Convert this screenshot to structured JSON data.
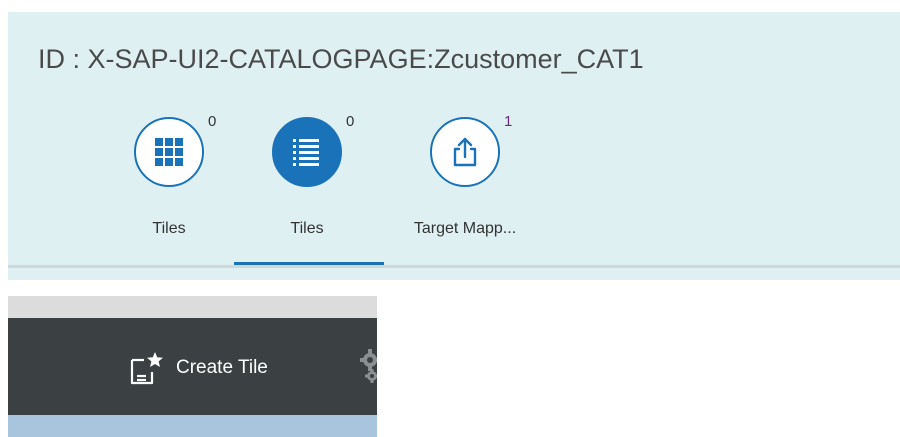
{
  "header": {
    "title": "ID : X-SAP-UI2-CATALOGPAGE:Zcustomer_CAT1"
  },
  "tabs": [
    {
      "label": "Tiles",
      "count": "0",
      "icon": "grid-icon",
      "selected": false
    },
    {
      "label": "Tiles",
      "count": "0",
      "icon": "list-icon",
      "selected": true
    },
    {
      "label": "Target Mapp...",
      "count": "1",
      "icon": "share-upload-icon",
      "selected": false
    }
  ],
  "toolbar": {
    "create_tile_label": "Create Tile",
    "create_tile_icon": "create-tile-icon",
    "overflow_icon": "gear-icon"
  },
  "colors": {
    "panel_bg": "#dff0f3",
    "accent": "#1a73b8",
    "toolbar_bg": "#3b4143",
    "count_purple": "#6b2a7e"
  }
}
